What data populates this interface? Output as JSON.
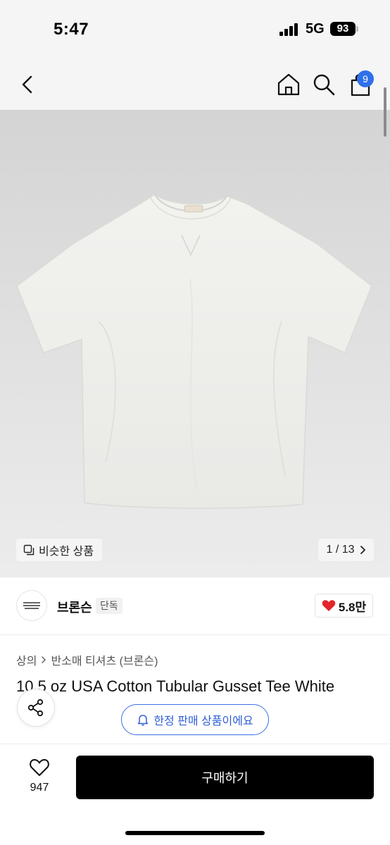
{
  "status_bar": {
    "time": "5:47",
    "network": "5G",
    "battery": "93"
  },
  "nav": {
    "back_icon": "chevron-left-icon",
    "home_icon": "home-icon",
    "search_icon": "search-icon",
    "cart_icon": "shopping-bag-icon",
    "cart_badge": "9"
  },
  "gallery": {
    "similar_label": "비슷한 상품",
    "page_indicator": "1 / 13"
  },
  "brand": {
    "name": "브론슨",
    "tag": "단독",
    "like_count": "5.8만"
  },
  "breadcrumb": {
    "level1": "상의",
    "level2": "반소매 티셔츠 (브론슨)"
  },
  "product": {
    "title": "10.5 oz USA Cotton Tubular Gusset Tee White"
  },
  "badges": {
    "limited_label": "한정 판매 상품이에요"
  },
  "bottom": {
    "wish_count": "947",
    "buy_label": "구매하기"
  },
  "colors": {
    "accent_blue": "#2f6fea",
    "heart_red": "#e3242b",
    "buy_black": "#000000"
  }
}
